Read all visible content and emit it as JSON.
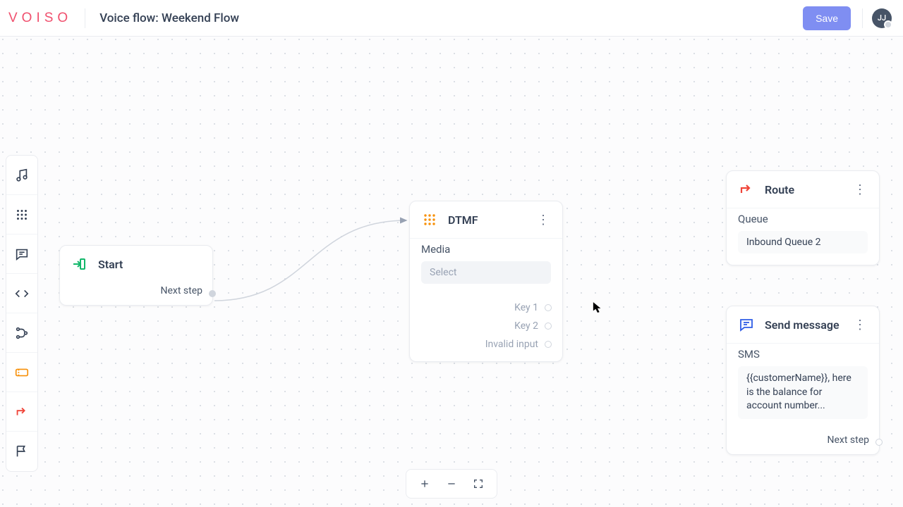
{
  "header": {
    "logo": "VOISO",
    "title": "Voice flow: Weekend Flow",
    "save": "Save",
    "avatar": "JJ"
  },
  "toolbar_icons": [
    "music-icon",
    "dialpad-icon",
    "message-icon",
    "code-icon",
    "branch-icon",
    "ticket-icon",
    "route-arrow-icon",
    "flag-icon"
  ],
  "nodes": {
    "start": {
      "title": "Start",
      "next": "Next step"
    },
    "dtmf": {
      "title": "DTMF",
      "media_label": "Media",
      "select_placeholder": "Select",
      "outputs": [
        "Key 1",
        "Key 2",
        "Invalid input"
      ]
    },
    "route": {
      "title": "Route",
      "field_label": "Queue",
      "field_value": "Inbound Queue 2"
    },
    "send": {
      "title": "Send message",
      "field_label": "SMS",
      "field_value": "{{customerName}}, here is the balance for account number...",
      "next": "Next step"
    }
  },
  "bottom": {
    "plus": "+",
    "minus": "−",
    "fullscreen": "⛶"
  }
}
